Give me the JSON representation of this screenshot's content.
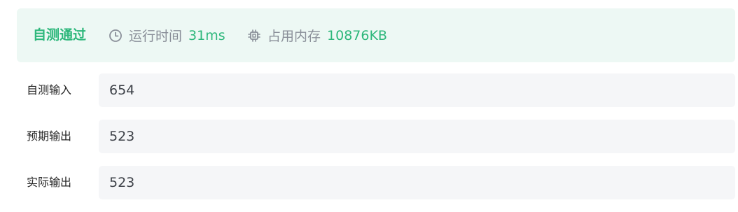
{
  "result": {
    "status": "自测通过",
    "runtime_label": "运行时间",
    "runtime_value": "31ms",
    "memory_label": "占用内存",
    "memory_value": "10876KB",
    "accent_color": "#2db77b",
    "banner_bg": "#edf8f4",
    "icons": {
      "runtime": "clock-icon",
      "memory": "chip-icon"
    }
  },
  "io": [
    {
      "label": "自测输入",
      "value": "654"
    },
    {
      "label": "预期输出",
      "value": "523"
    },
    {
      "label": "实际输出",
      "value": "523"
    }
  ]
}
